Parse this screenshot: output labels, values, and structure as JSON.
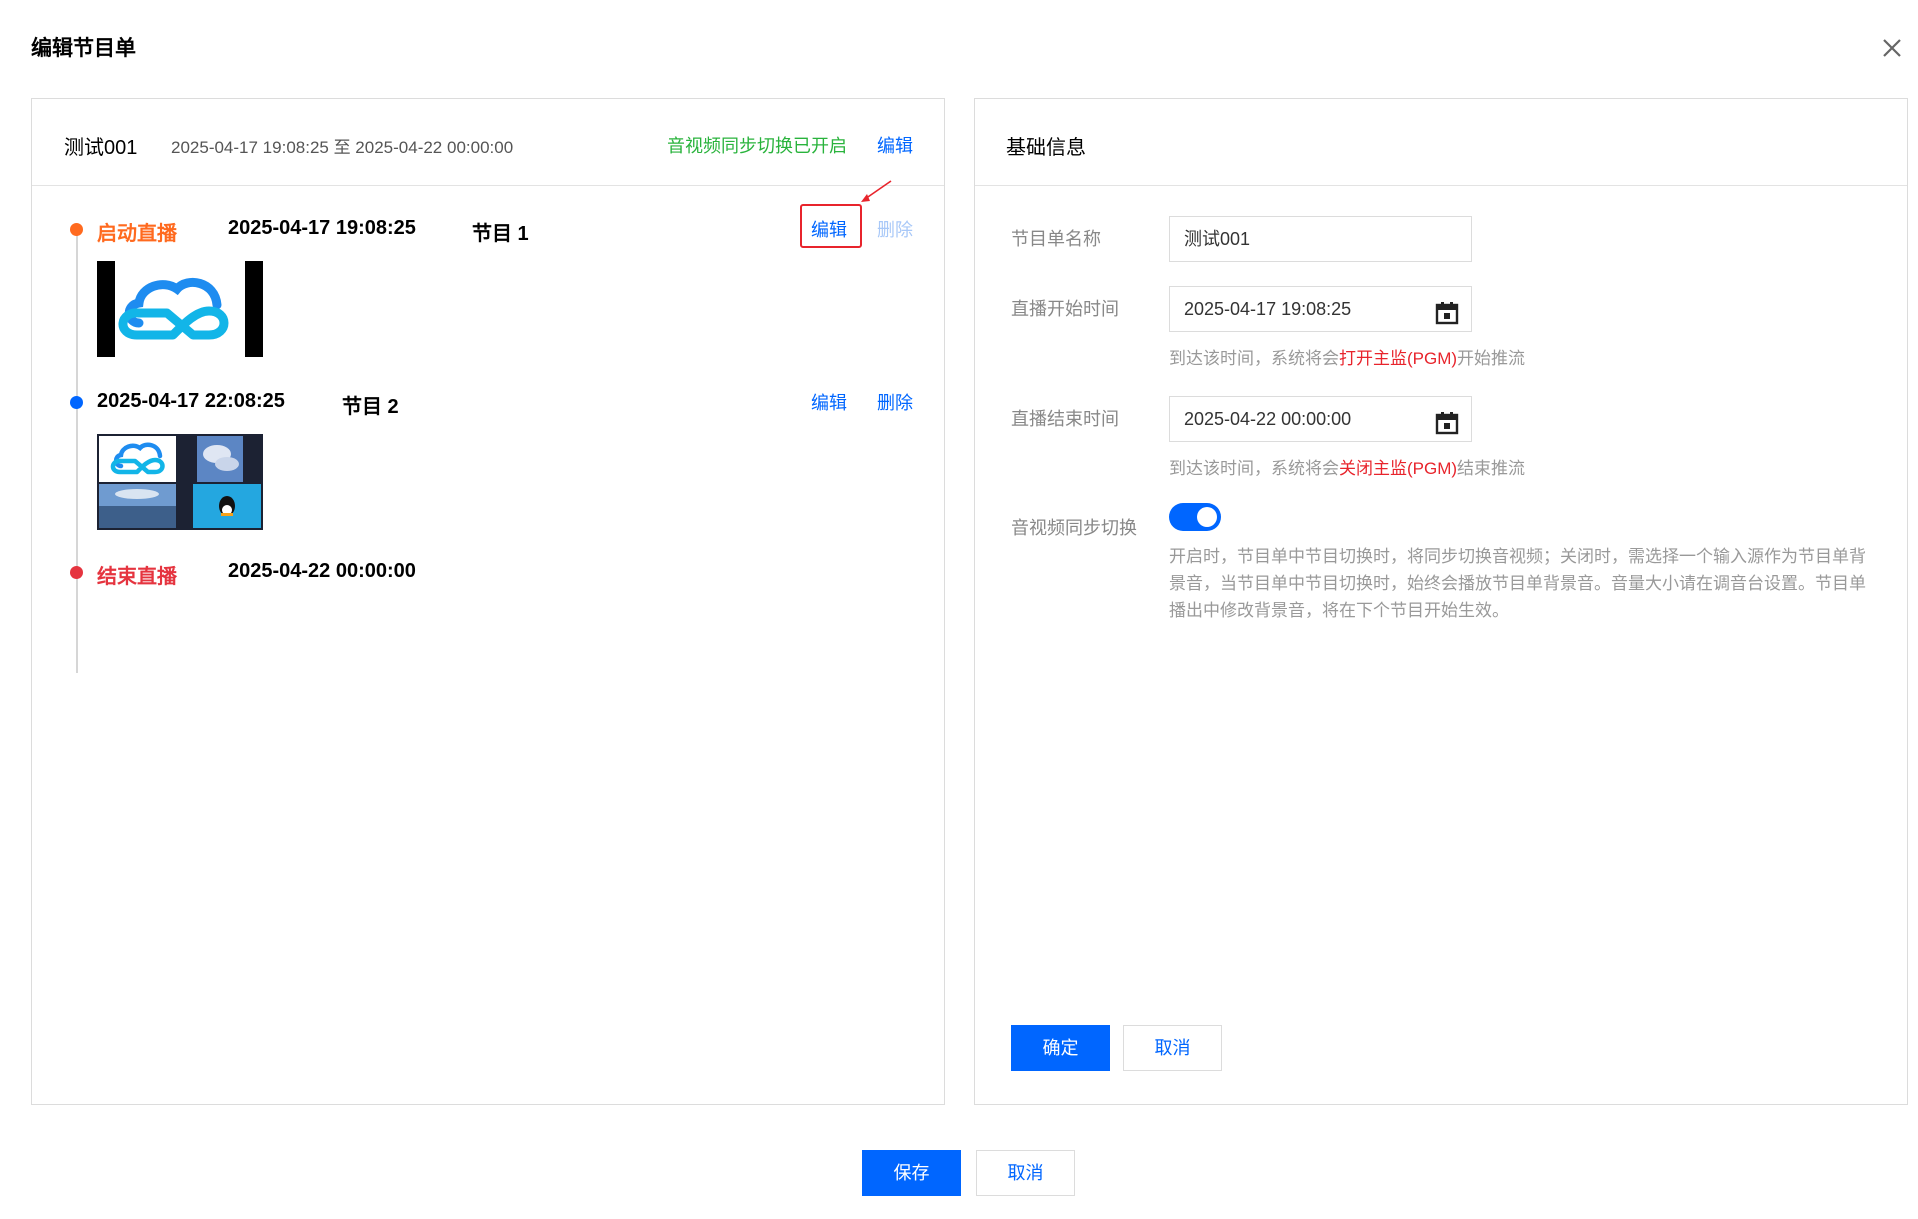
{
  "dialog": {
    "title": "编辑节目单"
  },
  "schedule": {
    "name": "测试001",
    "range": "2025-04-17 19:08:25 至 2025-04-22 00:00:00",
    "sync_status": "音视频同步切换已开启",
    "edit_label": "编辑"
  },
  "timeline": {
    "start": {
      "label": "启动直播",
      "time": "2025-04-17 19:08:25",
      "program": "节目 1",
      "edit": "编辑",
      "delete": "删除"
    },
    "second": {
      "time": "2025-04-17 22:08:25",
      "program": "节目 2",
      "edit": "编辑",
      "delete": "删除"
    },
    "end": {
      "label": "结束直播",
      "time": "2025-04-22 00:00:00"
    }
  },
  "basic_info": {
    "title": "基础信息",
    "name_label": "节目单名称",
    "name_value": "测试001",
    "start_label": "直播开始时间",
    "start_value": "2025-04-17 19:08:25",
    "start_hint_pre": "到达该时间，系统将会",
    "start_hint_red": "打开主监(PGM)",
    "start_hint_post": "开始推流",
    "end_label": "直播结束时间",
    "end_value": "2025-04-22 00:00:00",
    "end_hint_pre": "到达该时间，系统将会",
    "end_hint_red": "关闭主监(PGM)",
    "end_hint_post": "结束推流",
    "sync_label": "音视频同步切换",
    "sync_on": true,
    "sync_desc": "开启时，节目单中节目切换时，将同步切换音视频；关闭时，需选择一个输入源作为节目单背景音，当节目单中节目切换时，始终会播放节目单背景音。音量大小请在调音台设置。节目单播出中修改背景音，将在下个节目开始生效。",
    "confirm": "确定",
    "cancel": "取消"
  },
  "footer": {
    "save": "保存",
    "cancel": "取消"
  },
  "colors": {
    "primary": "#0066ff",
    "start_orange": "#ff6a1f",
    "end_red": "#e5343f",
    "sync_green": "#29b33c",
    "annotation_red": "#e8242c"
  },
  "icons": {
    "close": "close-icon",
    "calendar": "calendar-icon",
    "cloud_logo": "cloud-logo-icon"
  }
}
